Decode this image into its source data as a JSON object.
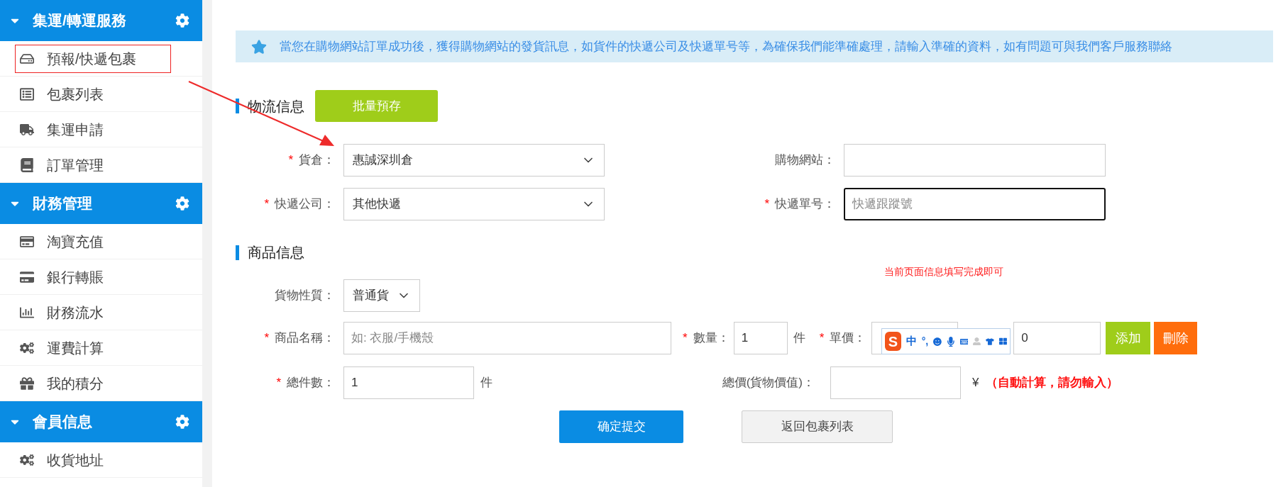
{
  "required_mark": "*",
  "sidebar": {
    "groups": [
      {
        "title": "集運/轉運服務",
        "expanded": true,
        "items": [
          {
            "label": "預報/快遞包裹",
            "annotated": true
          },
          {
            "label": "包裹列表",
            "annotated": false
          },
          {
            "label": "集運申請",
            "annotated": false
          },
          {
            "label": "訂單管理",
            "annotated": false
          }
        ]
      },
      {
        "title": "財務管理",
        "expanded": true,
        "items": [
          {
            "label": "淘寶充值",
            "annotated": false
          },
          {
            "label": "銀行轉賬",
            "annotated": false
          },
          {
            "label": "財務流水",
            "annotated": false
          },
          {
            "label": "運費計算",
            "annotated": false
          },
          {
            "label": "我的積分",
            "annotated": false
          }
        ]
      },
      {
        "title": "會員信息",
        "expanded": true,
        "items": [
          {
            "label": "收貨地址",
            "annotated": false
          }
        ]
      }
    ]
  },
  "notice": {
    "text": "當您在購物網站訂單成功後，獲得購物網站的發貨訊息，如貨件的快遞公司及快遞單号等，為確保我們能準確處理，請輸入準確的資料，如有問題可與我們客戶服務聯絡"
  },
  "logistics": {
    "title": "物流信息",
    "batch_button": "批量預存",
    "fields": [
      {
        "label": "貨倉：",
        "required": true,
        "kind": "select",
        "value": "惠誠深圳倉"
      },
      {
        "label": "購物網站：",
        "kind": "input",
        "focused": false
      },
      {
        "label": "快遞公司：",
        "required": true,
        "kind": "select",
        "value": "其他快遞"
      },
      {
        "label": "快遞單号：",
        "required": true,
        "kind": "input",
        "placeholder": "快遞跟蹤號",
        "focused": true
      }
    ]
  },
  "goods": {
    "title": "商品信息",
    "note": "当前页面信息填写完成即可",
    "nature": {
      "label": "貨物性質：",
      "value": "普通貨"
    },
    "item": {
      "name": {
        "label": "商品名稱：",
        "required": true,
        "placeholder": "如: 衣服/手機殼"
      },
      "qty": {
        "label": "數量：",
        "required": true,
        "value": "1",
        "unit": "件"
      },
      "price": {
        "label": "單價：",
        "required": true
      },
      "total": {
        "value": "0"
      },
      "add_button": "添加",
      "delete_button": "刪除"
    },
    "count": {
      "label": "總件數：",
      "required": true,
      "value": "1",
      "unit": "件"
    },
    "total_price": {
      "label": "總價(貨物價值)：",
      "currency": "¥",
      "hint": "（自動計算，請勿輸入）"
    }
  },
  "ime_toolbar": {
    "logo": "S",
    "mode": "中",
    "punctuation": "°,"
  },
  "actions": {
    "submit": "确定提交",
    "back": "返回包裹列表"
  }
}
